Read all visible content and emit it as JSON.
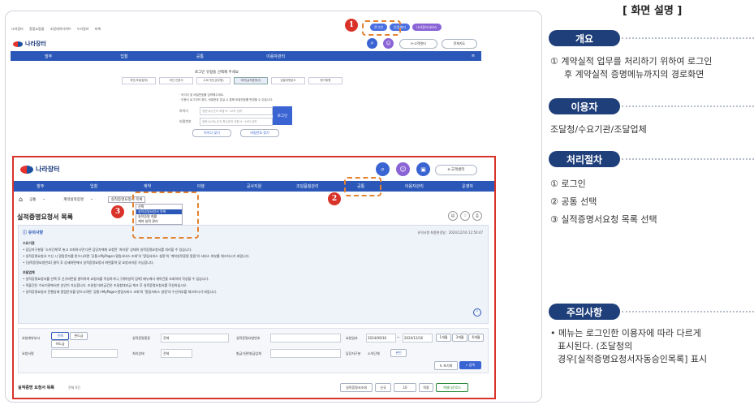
{
  "panel": {
    "title": "[ 화면 설명 ]",
    "sections": {
      "overview": {
        "label": "개요",
        "lines": [
          "① 계약실적 업무를 처리하기 위하여 로그인",
          "후 계약실적 증명메뉴까지의 경로화면"
        ]
      },
      "users": {
        "label": "이용자",
        "lines": [
          "조달청/수요기관/조달업체"
        ]
      },
      "procedure": {
        "label": "처리절차",
        "lines": [
          "① 로그인",
          "② 공통 선택",
          "③ 실적증명서요청 목록 선택"
        ]
      },
      "notes": {
        "label": "주의사항",
        "lines": [
          "• 메뉴는 로그인한 이용자에 따라 다르게",
          "표시된다. (조달청의",
          "경우[실적증명요청서자동승인목록] 표시"
        ]
      }
    }
  },
  "top_shot": {
    "util_links": [
      "나라장터",
      "종합쇼핑몰",
      "조달데이터허브",
      "누리장터",
      "비축"
    ],
    "login": "로그인",
    "signup": "인증센터",
    "service": "나라장터서비스",
    "logo": "나라장터",
    "customer_center": "e-고객센터",
    "fullview": "전체지도",
    "nav": [
      "발주",
      "입찰",
      "공통",
      "이용자관리"
    ],
    "select_prompt": "로그인 유형을 선택해 주세요",
    "user_types": [
      "개인(조달업체)",
      "개인 인증서",
      "수요기관(공무원)",
      "계약(실적증명서)",
      "입찰대행공고",
      "평가위원"
    ],
    "info_lines": [
      "· 아이디 및 비밀번호를 입력해주세요.",
      "· 인증서 로그인의 경우, 비밀번호 분실 시 통해 비밀번호를 변경할 수 있습니다."
    ],
    "id_label": "아이디",
    "pw_label": "비밀번호",
    "id_placeholder": "영문(소)/숫자 조합 6~12자 입력",
    "pw_placeholder": "영문(소/대),숫자,특수문자 조합 9~16자 입력",
    "login_btn": "로그인",
    "find_id": "아이디 찾기",
    "find_pw": "비밀번호 찾기"
  },
  "big_shot": {
    "logo": "나라장터",
    "customer_center": "e-고객센터",
    "nav": [
      "발주",
      "입찰",
      "계약",
      "이행",
      "공사지원",
      "조달품질관리",
      "공통",
      "이용자관리",
      "운영자"
    ],
    "breadcrumb": [
      "공통",
      "계약실적증명",
      "실적증명요청서 목록"
    ],
    "dropdown": [
      "선택",
      "실적증명요청서 목록",
      "실적증명 현황",
      "계약 실적 관리"
    ],
    "page_title": "실적증명요청서 목록",
    "notice_title": "유의사항",
    "updated": "유의사항 최종변경일 : 2024/12/16 12:50:47",
    "notice_sub1": "수요기관",
    "notice_lines1": [
      "• 담당자구분을 '소속단체'로 놓고 조회하시면 다른 담당자에게 요청된 '처리중' 상태의 실적증명요청서를 처리할 수 있습니다.",
      "• 실적증명요청서 수신 시 알림문자를 받으시려면 '공통>MyPage>알림서비스 조회'의 '알림서비스 설정'의 '계약실적증명 알림'의 서비스 여부를 체크하시기 바랍니다.",
      "• [실적증명요청번호] 클릭 후 상세화면에서 실적증명요청서 화면출력 및 요청서저장 가능합니다."
    ],
    "notice_sub2": "조달업체",
    "notice_lines2": [
      "• 실적증명요청서를 선택 후 신규버튼을 클릭하여 요청서를 작성하거나, [계약실적 검색] 메뉴에서 계약건을 조회하여 작성할 수 있습니다.",
      "• 직불건은 수요기관에서만 승인이 가능합니다. 조달청 대지급건은 조달청대리급 체크 후 실적증명요청서를 작성하십시오.",
      "• 실적증명요청서 진행상태 알림문자를 받으시려면 '공통>MyPage>알림서비스 조회'의 '알림서비스 설정'의 수신여부를 체크하시기 바랍니다."
    ],
    "filters": {
      "req_org": "요청계약부서",
      "opt_all": "전체",
      "opt_contract": "완도급",
      "opt_sub": "하도급",
      "doc_type": "실적증명종류",
      "doc_type_val": "전체",
      "req_no": "실적증명요청번호",
      "req_date": "요청일자",
      "date_from": "2024/09/16",
      "date_to": "2024/12/16",
      "m1": "1개월",
      "m3": "3개월",
      "m6": "6개월",
      "requester": "요청서명",
      "status": "처리상태",
      "status_val": "전체",
      "issuer": "발급기관/발급업체",
      "manager": "담당자구분",
      "manager_val": "소속단체",
      "mine": "본인",
      "reset": "초기화",
      "search": "검색"
    },
    "list_title": "실적증명 요청서 목록",
    "list_count": "전체 0건",
    "bottom_btns": [
      "실적증명서조회",
      "신규",
      "10",
      "적용",
      "엑셀다운로드"
    ]
  },
  "badges": [
    "1",
    "2",
    "3"
  ]
}
